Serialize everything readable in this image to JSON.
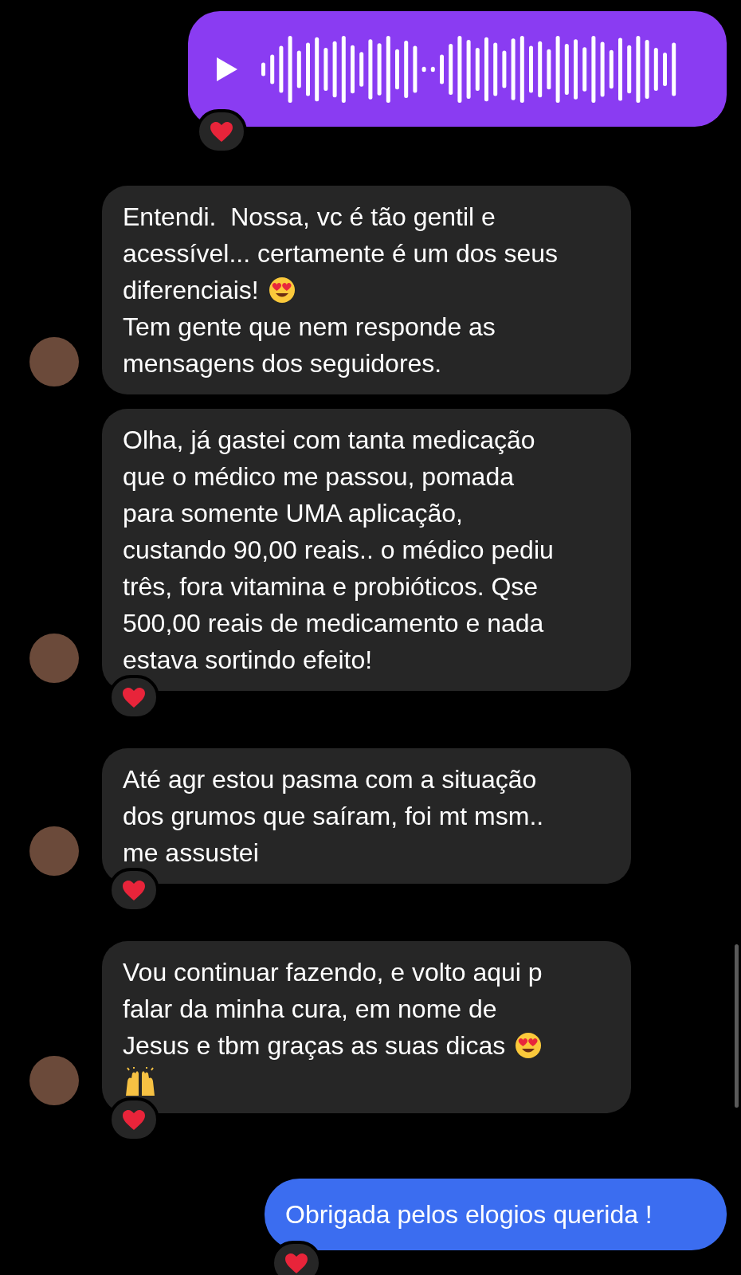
{
  "messages": [
    {
      "kind": "voice",
      "sent": true,
      "liked": true
    },
    {
      "kind": "text",
      "sent": false,
      "liked": false,
      "lines": [
        [
          {
            "kind": "text",
            "text": "Entendi.  Nossa, vc é tão gentil e"
          }
        ],
        [
          {
            "kind": "text",
            "text": "acessível... certamente é um dos seus"
          }
        ],
        [
          {
            "kind": "text",
            "text": "diferenciais!"
          },
          {
            "kind": "heart-eyes"
          }
        ],
        [
          {
            "kind": "text",
            "text": "Tem gente que nem responde as"
          }
        ],
        [
          {
            "kind": "text",
            "text": "mensagens dos seguidores."
          }
        ]
      ]
    },
    {
      "kind": "text",
      "sent": false,
      "liked": true,
      "lines": [
        [
          {
            "kind": "text",
            "text": "Olha, já gastei com tanta medicação"
          }
        ],
        [
          {
            "kind": "text",
            "text": "que o médico me passou, pomada"
          }
        ],
        [
          {
            "kind": "text",
            "text": "para somente UMA aplicação,"
          }
        ],
        [
          {
            "kind": "text",
            "text": "custando 90,00 reais.. o médico pediu"
          }
        ],
        [
          {
            "kind": "text",
            "text": "três, fora vitamina e probióticos. Qse"
          }
        ],
        [
          {
            "kind": "text",
            "text": "500,00 reais de medicamento e nada"
          }
        ],
        [
          {
            "kind": "text",
            "text": "estava sortindo efeito!"
          }
        ]
      ]
    },
    {
      "kind": "text",
      "sent": false,
      "liked": true,
      "lines": [
        [
          {
            "kind": "text",
            "text": "Até agr estou pasma com a situação"
          }
        ],
        [
          {
            "kind": "text",
            "text": "dos grumos que saíram, foi mt msm.."
          }
        ],
        [
          {
            "kind": "text",
            "text": "me assustei"
          }
        ]
      ]
    },
    {
      "kind": "text",
      "sent": false,
      "liked": true,
      "lines": [
        [
          {
            "kind": "text",
            "text": "Vou continuar fazendo, e volto aqui p"
          }
        ],
        [
          {
            "kind": "text",
            "text": "falar da minha cura, em nome de"
          }
        ],
        [
          {
            "kind": "text",
            "text": "Jesus e tbm graças as suas dicas"
          },
          {
            "kind": "heart-eyes"
          }
        ],
        [
          {
            "kind": "raised-hands"
          }
        ]
      ]
    },
    {
      "kind": "text",
      "sent": true,
      "liked": true,
      "lines": [
        [
          {
            "kind": "text",
            "text": "Obrigada pelos elogios querida !"
          }
        ]
      ]
    }
  ]
}
